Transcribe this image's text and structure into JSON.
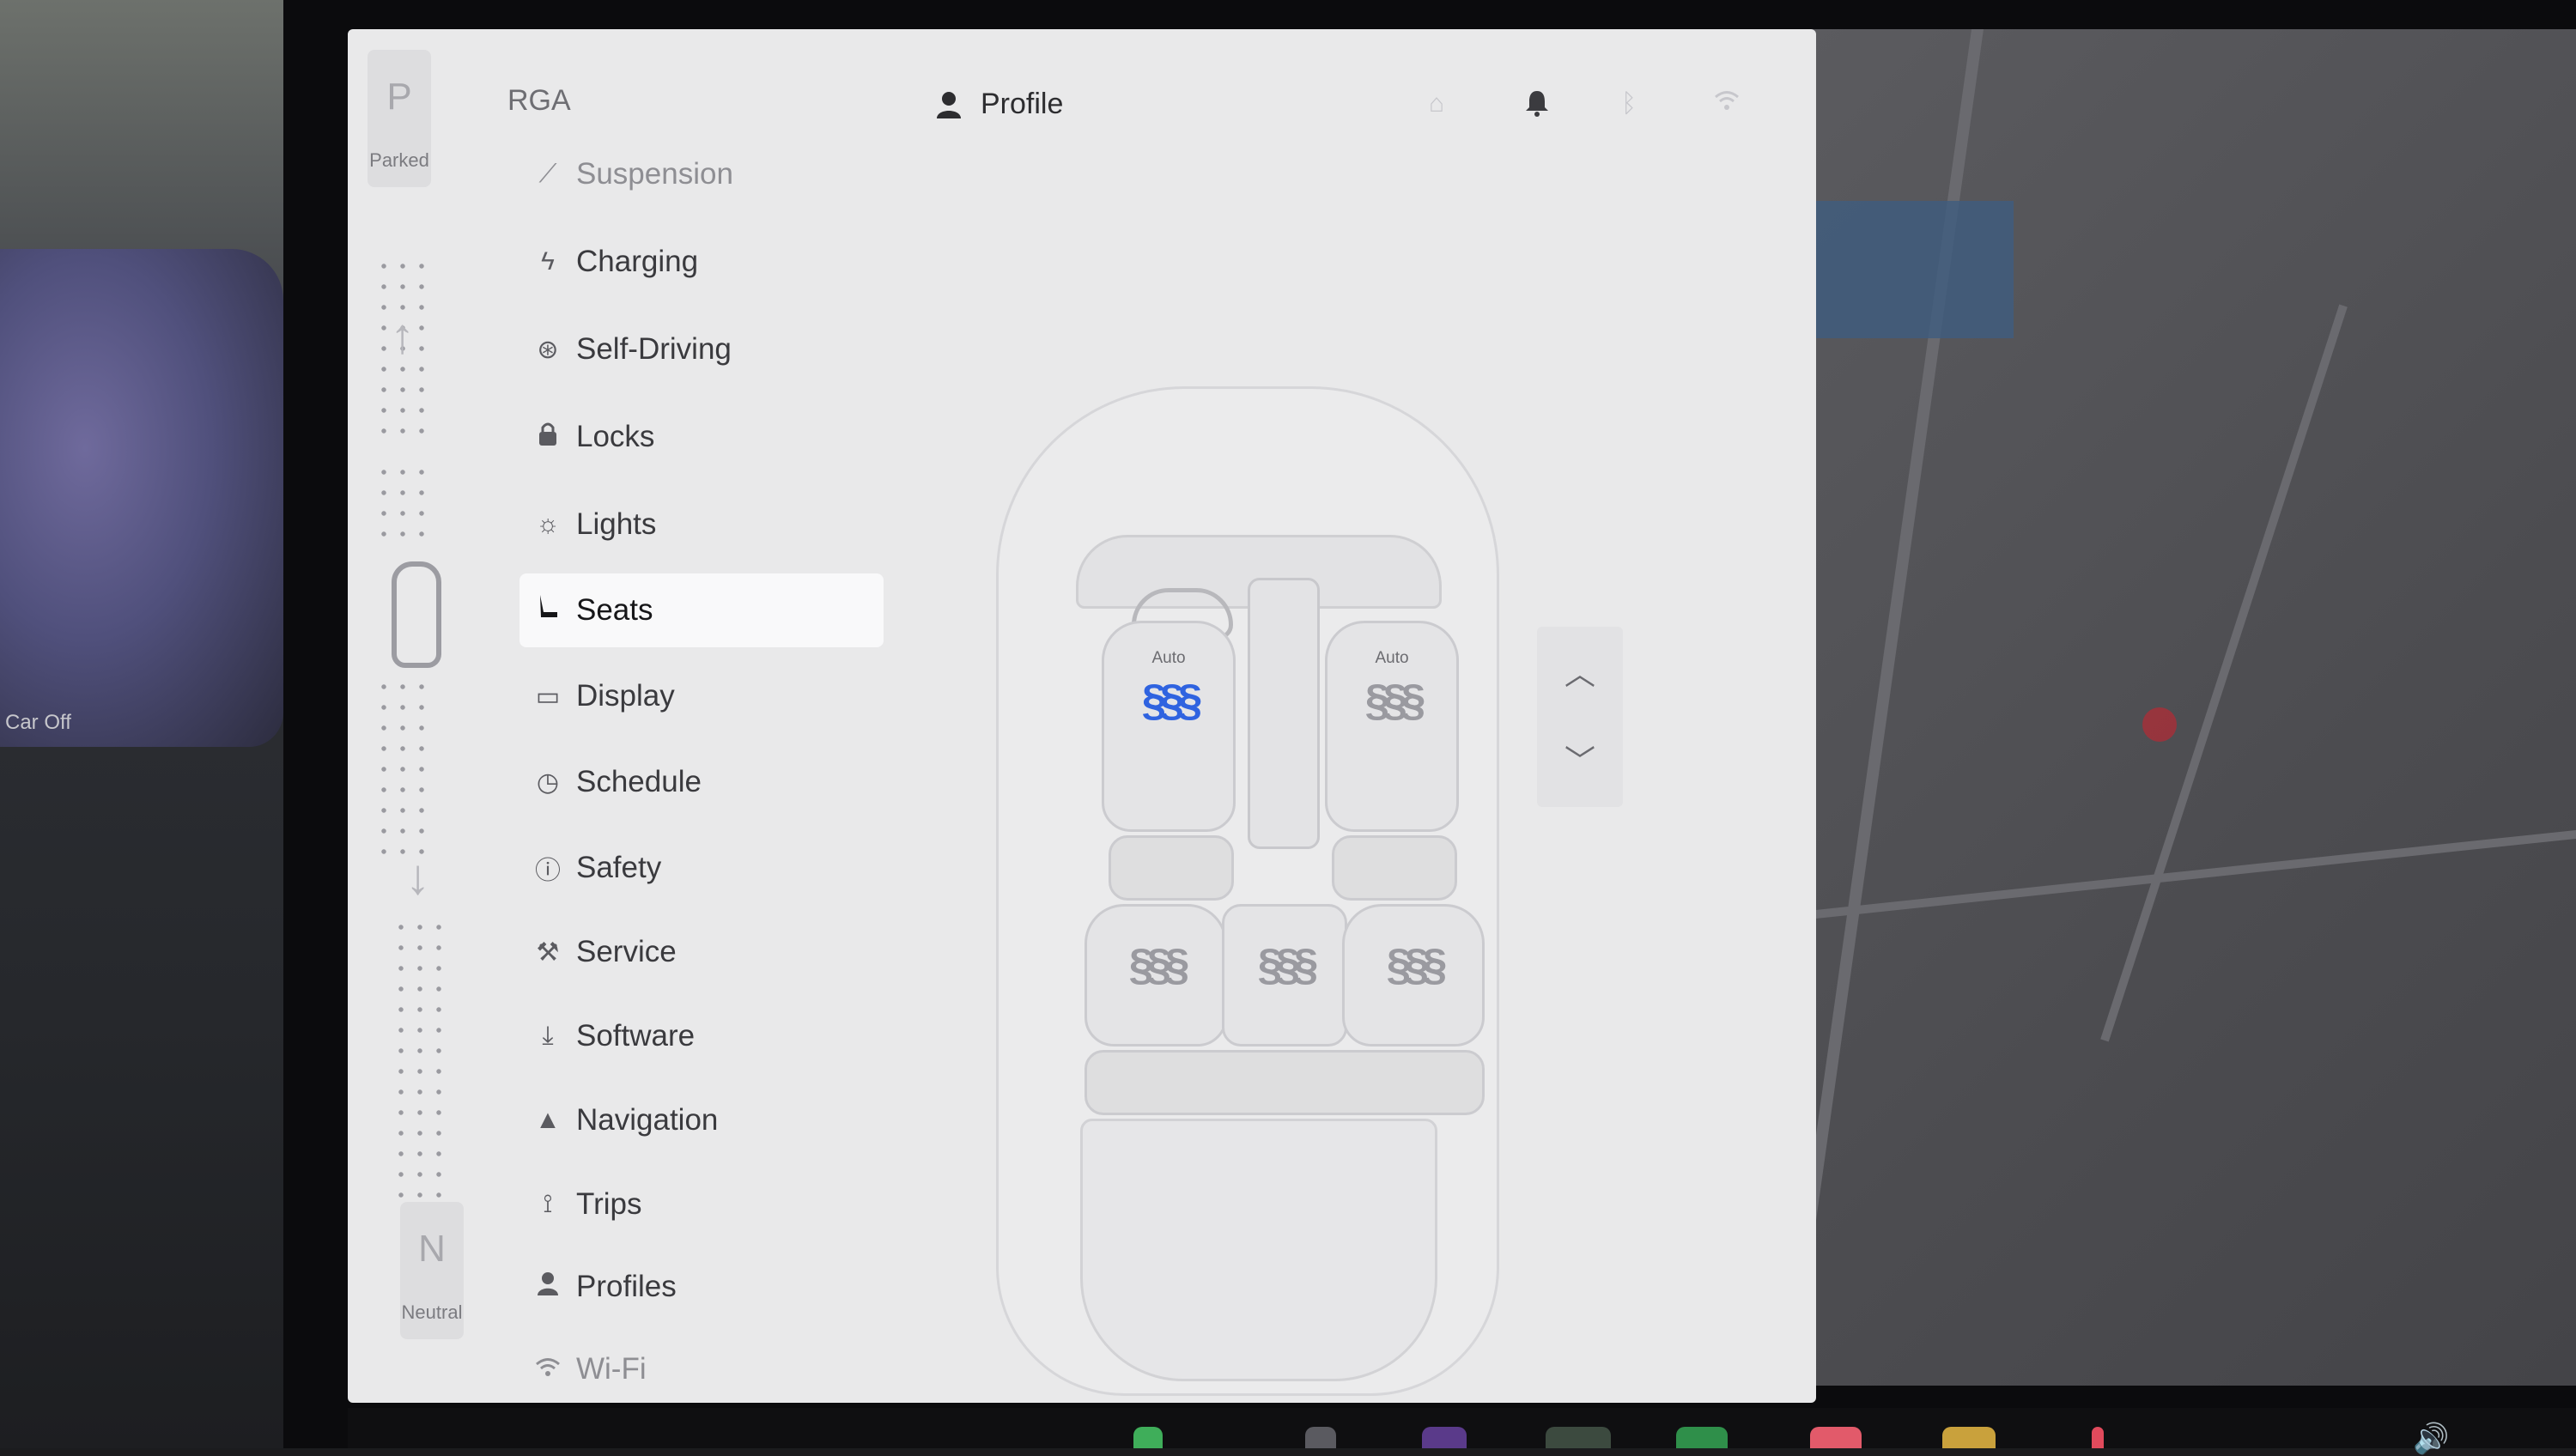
{
  "background": {
    "cluster_status": "Car Off"
  },
  "gear": {
    "top_letter": "P",
    "top_label": "Parked",
    "bottom_letter": "N",
    "bottom_label": "Neutral"
  },
  "header": {
    "title": "RGA",
    "profile_label": "Profile",
    "icons": [
      "user-icon",
      "home-icon",
      "bell-icon",
      "bluetooth-icon",
      "wifi-icon"
    ]
  },
  "menu": {
    "selected": "Seats",
    "items": [
      {
        "label": "Suspension",
        "icon": "suspension-icon"
      },
      {
        "label": "Charging",
        "icon": "bolt-icon"
      },
      {
        "label": "Self-Driving",
        "icon": "steering-wheel-icon"
      },
      {
        "label": "Locks",
        "icon": "lock-icon"
      },
      {
        "label": "Lights",
        "icon": "light-icon"
      },
      {
        "label": "Seats",
        "icon": "seat-icon"
      },
      {
        "label": "Display",
        "icon": "display-icon"
      },
      {
        "label": "Schedule",
        "icon": "clock-icon"
      },
      {
        "label": "Safety",
        "icon": "alert-icon"
      },
      {
        "label": "Service",
        "icon": "wrench-icon"
      },
      {
        "label": "Software",
        "icon": "download-icon"
      },
      {
        "label": "Navigation",
        "icon": "navigation-icon"
      },
      {
        "label": "Trips",
        "icon": "trips-icon"
      },
      {
        "label": "Profiles",
        "icon": "user-icon"
      },
      {
        "label": "Wi-Fi",
        "icon": "wifi-icon"
      }
    ]
  },
  "seats": {
    "front_left": {
      "label": "Auto",
      "heater_glyph": "§§§",
      "active": true
    },
    "front_right": {
      "label": "Auto",
      "heater_glyph": "§§§",
      "active": false
    },
    "rear_left": {
      "heater_glyph": "§§§",
      "active": false
    },
    "rear_center": {
      "heater_glyph": "§§§",
      "active": false
    },
    "rear_right": {
      "heater_glyph": "§§§",
      "active": false
    }
  },
  "colors": {
    "screen_bg": "#e9e9ea",
    "selected_bg": "#f9f9fa",
    "heater_active": "#2f63e0",
    "heater_inactive": "#9a9aa0"
  }
}
